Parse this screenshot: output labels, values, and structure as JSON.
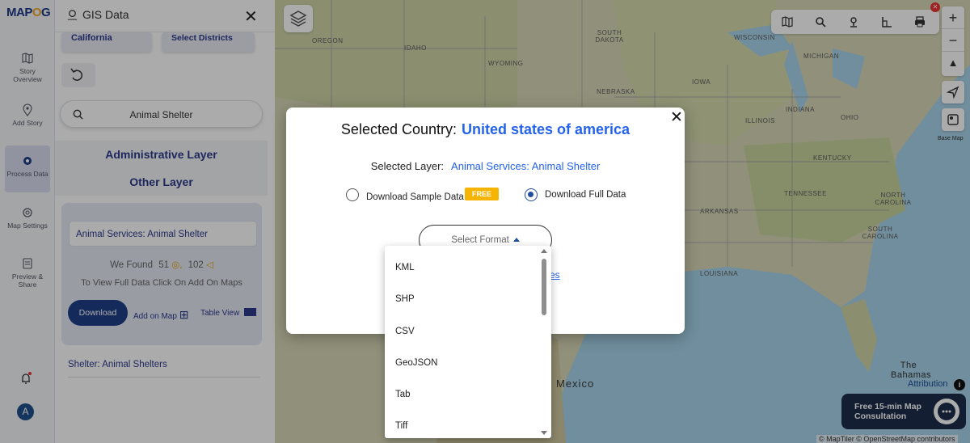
{
  "app": {
    "logo": "MAPOG",
    "panel_title": "GIS Data"
  },
  "rail": {
    "items": [
      {
        "label": "Story Overview",
        "icon": "map-icon"
      },
      {
        "label": "Add Story",
        "icon": "pin-icon"
      },
      {
        "label": "Process Data",
        "icon": "gear-icon"
      },
      {
        "label": "Map Settings",
        "icon": "gear-icon"
      },
      {
        "label": "Preview & Share",
        "icon": "preview-icon"
      }
    ],
    "avatar": "A"
  },
  "panel": {
    "state_button": "California",
    "districts_button": "Select Districts",
    "search_value": "Animal Shelter",
    "admin_layer": "Administrative Layer",
    "other_layer": "Other Layer",
    "card": {
      "layer_name": "Animal Services: Animal Shelter",
      "found_prefix": "We Found",
      "found_points": "51",
      "found_areas": "102",
      "hint": "To View Full Data Click On Add On Maps",
      "download": "Download",
      "add_on_map": "Add on Map",
      "table_view": "Table View"
    },
    "shelter_item": "Shelter: Animal Shelters"
  },
  "map": {
    "labels": {
      "oregon": "OREGON",
      "idaho": "IDAHO",
      "wyoming": "WYOMING",
      "south_dakota": "SOUTH\nDAKOTA",
      "nebraska": "NEBRASKA",
      "iowa": "IOWA",
      "wisconsin": "WISCONSIN",
      "michigan": "MICHIGAN",
      "indiana": "INDIANA",
      "ohio": "OHIO",
      "illinois": "ILLINOIS",
      "kentucky": "KENTUCKY",
      "tennessee": "TENNESSEE",
      "arkansas": "ARKANSAS",
      "north_carolina": "NORTH\nCAROLINA",
      "south_carolina": "SOUTH\nCAROLINA",
      "louisiana": "LOUISIANA",
      "mexico": "Mexico",
      "bahamas": "The\nBahamas"
    },
    "attribution": "Attribution",
    "copyright": "© MapTiler © OpenStreetMap contributors",
    "consult": "Free 15-min Map Consultation"
  },
  "modal": {
    "title_prefix": "Selected Country:",
    "country": "United states of america",
    "layer_prefix": "Selected Layer:",
    "layer_value": "Animal Services: Animal Shelter",
    "sample_label": "Download Sample Data",
    "free_badge": "FREE",
    "full_label": "Download Full Data",
    "selected_option": "full",
    "select_format": "Select Format",
    "hidden_link": "es"
  },
  "dropdown": {
    "options": [
      "KML",
      "SHP",
      "CSV",
      "GeoJSON",
      "Tab",
      "Tiff"
    ]
  },
  "colors": {
    "accent": "#2563eb",
    "brand_navy": "#1e3f88",
    "free": "#f5b400"
  }
}
